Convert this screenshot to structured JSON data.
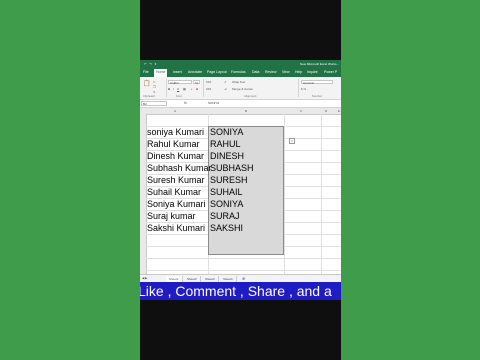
{
  "title_bar": {
    "doc_title": "New Microsoft Excel Works..."
  },
  "tabs": [
    "File",
    "Home",
    "Insert",
    "Annotate",
    "Page Layout",
    "Formulas",
    "Data",
    "Review",
    "View",
    "Help",
    "Inquire",
    "Power P"
  ],
  "ribbon": {
    "font_name": "Calibri",
    "font_size": "11",
    "wrap_text": "Wrap Text",
    "merge_center": "Merge & Center",
    "number_format": "General",
    "groups": {
      "clipboard": "Clipboard",
      "font": "Font",
      "alignment": "Alignment",
      "number": "Number"
    }
  },
  "formula_bar": {
    "name_box": "B2",
    "fx": "fx",
    "value": "SONIYA"
  },
  "columns": [
    "A",
    "B",
    "C",
    "D",
    "E"
  ],
  "rows": [
    {
      "a": "soniya Kumari",
      "b": "SONIYA"
    },
    {
      "a": "Rahul  Kumar",
      "b": "RAHUL"
    },
    {
      "a": "Dinesh Kumar",
      "b": "DINESH"
    },
    {
      "a": "Subhash Kumar",
      "b": "SUBHASH"
    },
    {
      "a": "Suresh Kumar",
      "b": "SURESH"
    },
    {
      "a": "Suhail Kumar",
      "b": "SUHAIL"
    },
    {
      "a": "Soniya Kumari",
      "b": "SONIYA"
    },
    {
      "a": "Suraj kumar",
      "b": "SURAJ"
    },
    {
      "a": "Sakshi Kumari",
      "b": "SAKSHI"
    }
  ],
  "sheets": [
    "Sheet1",
    "Sheet2",
    "Sheet3",
    "Sheet4"
  ],
  "caption": "Like , Comment , Share , and a",
  "colors": {
    "excel_green": "#217346",
    "side_green": "#3e9c4a",
    "caption_blue": "#201cc4"
  }
}
